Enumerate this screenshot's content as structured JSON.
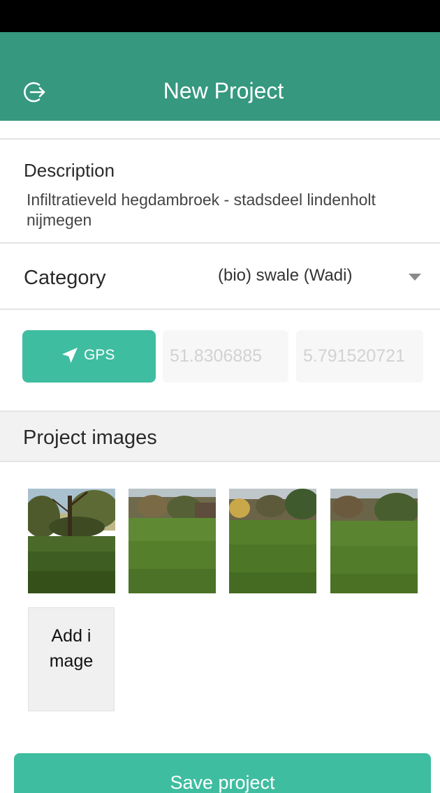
{
  "header": {
    "title": "New Project",
    "back_icon": "logout-arrow-circle-icon"
  },
  "description": {
    "label": "Description",
    "value": "Infiltratieveld hegdambroek - stadsdeel lindenholt nijmegen"
  },
  "category": {
    "label": "Category",
    "selected": "(bio) swale (Wadi)",
    "caret_icon": "caret-down-icon"
  },
  "location": {
    "gps_button_label": "GPS",
    "gps_icon": "location-arrow-icon",
    "latitude": "51.8306885",
    "longitude": "5.791520721"
  },
  "images": {
    "section_title": "Project images",
    "thumbnails": [
      {
        "name": "park-photo"
      },
      {
        "name": "lawn-photo"
      },
      {
        "name": "lawn-photo"
      },
      {
        "name": "lawn-photo"
      }
    ],
    "add_label": "Add image"
  },
  "actions": {
    "save_label": "Save project"
  },
  "colors": {
    "header": "#35987f",
    "accent": "#3fbda0",
    "status_bar": "#000000"
  }
}
